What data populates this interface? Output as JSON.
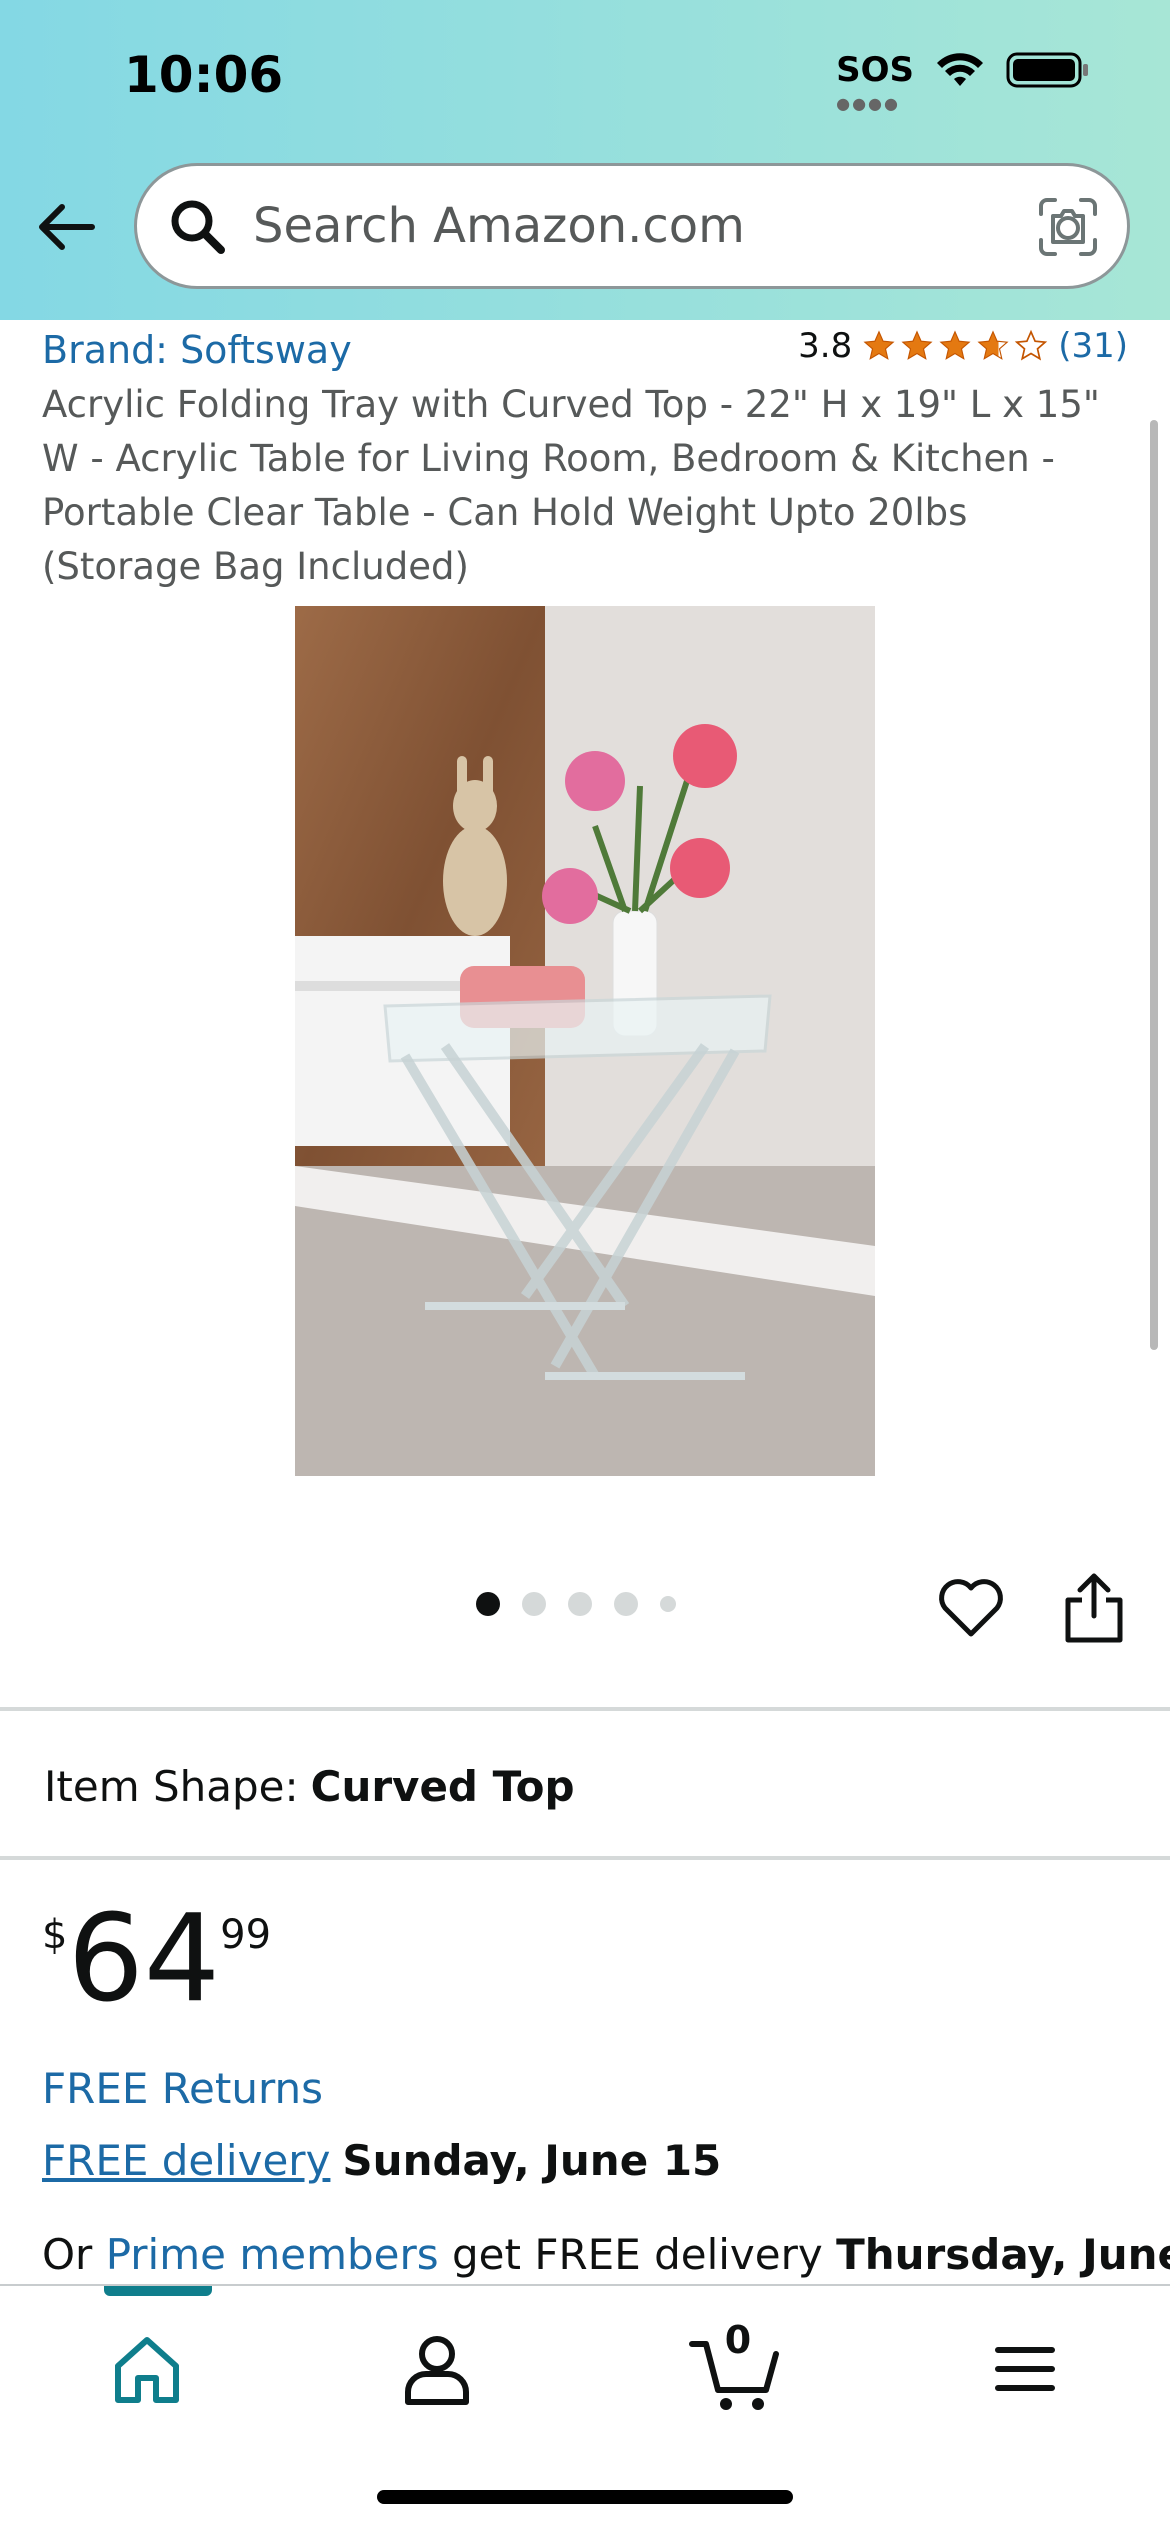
{
  "status_bar": {
    "time": "10:06",
    "sos": "SOS"
  },
  "search": {
    "placeholder": "Search Amazon.com"
  },
  "product": {
    "brand": "Brand: Softsway",
    "rating_value": "3.8",
    "rating_stars": 3.8,
    "rating_count": "(31)",
    "title": "Acrylic Folding Tray with Curved Top - 22\" H x 19\" L x 15\" W - Acrylic Table for Living Room, Bedroom & Kitchen - Portable Clear Table - Can Hold Weight Upto 20lbs (Storage Bag Included)"
  },
  "gallery": {
    "image_count": 5,
    "active_index": 0
  },
  "options": {
    "shape_label": "Item Shape:",
    "shape_value": "Curved Top"
  },
  "price": {
    "symbol": "$",
    "whole": "64",
    "fraction": "99"
  },
  "delivery": {
    "free_returns": "FREE Returns",
    "free_delivery_link": "FREE delivery",
    "free_delivery_date": "Sunday, June 15",
    "prime_prefix": "Or",
    "prime_link": "Prime members",
    "prime_text": "get FREE delivery",
    "prime_date": "Thursday, June"
  },
  "tabbar": {
    "cart_count": "0",
    "active_tab": "home"
  },
  "colors": {
    "accent_teal": "#0f7e8c",
    "link_blue": "#1c6aa6",
    "star_orange": "#e47911"
  }
}
